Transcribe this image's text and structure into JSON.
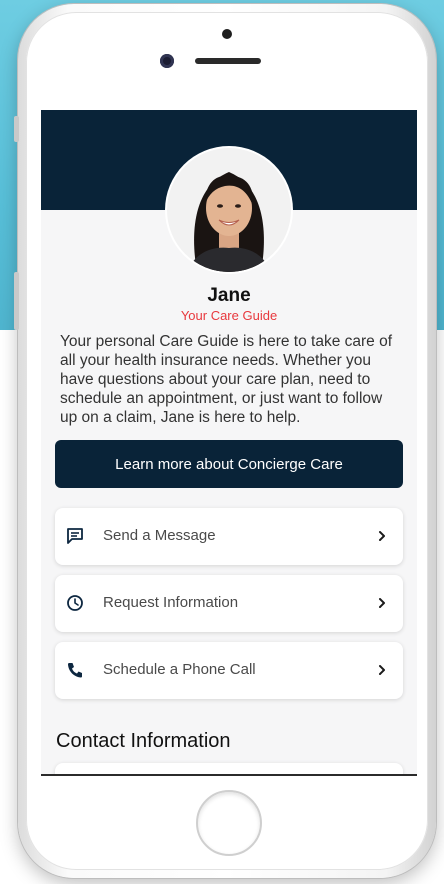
{
  "profile": {
    "name": "Jane",
    "role": "Your Care Guide",
    "intro": "Your personal Care Guide is here to take care of all your health insurance needs. Whether you have questions about your care plan, need to schedule an appointment, or just want to follow up on a claim, Jane is here to help."
  },
  "cta": {
    "label": "Learn more about Concierge Care"
  },
  "actions": [
    {
      "label": "Send a Message",
      "icon": "message-icon"
    },
    {
      "label": "Request Information",
      "icon": "clock-icon"
    },
    {
      "label": "Schedule a Phone Call",
      "icon": "phone-icon"
    }
  ],
  "contact": {
    "title": "Contact Information"
  },
  "colors": {
    "header_band": "#092338",
    "accent_red": "#e8383d",
    "screen_bg": "#f6f6f7",
    "backdrop_blue": "#58bfd8"
  }
}
